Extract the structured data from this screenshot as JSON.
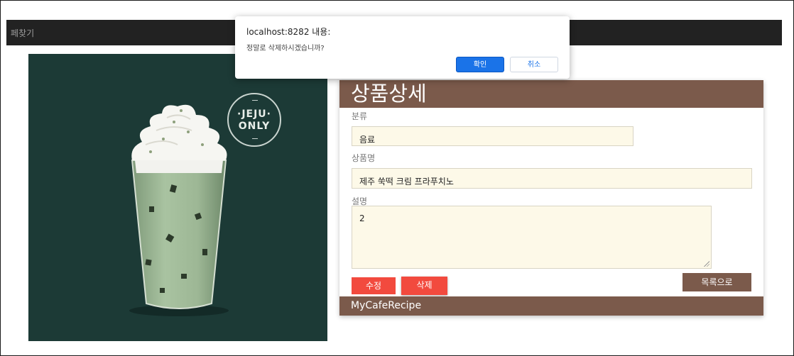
{
  "navbar": {
    "link_label": "페찾기"
  },
  "image": {
    "badge_line1": "·JEJU·",
    "badge_line2": "ONLY"
  },
  "detail": {
    "title": "상품상세",
    "category_label": "분류",
    "category_value": "음료",
    "name_label": "상품명",
    "name_value": "제주 쑥떡 크림 프라푸치노",
    "description_label": "설명",
    "description_value": "2",
    "edit_label": "수정",
    "delete_label": "삭제",
    "list_label": "목록으로",
    "footer": "MyCafeRecipe"
  },
  "dialog": {
    "title": "localhost:8282 내용:",
    "message": "정말로 삭제하시겠습니까?",
    "ok_label": "확인",
    "cancel_label": "취소"
  },
  "colors": {
    "brand": "#7b5a4b",
    "danger": "#f24a3e",
    "navbar": "#222222",
    "field_bg": "#fdf9e8",
    "primary": "#1a73e8"
  }
}
